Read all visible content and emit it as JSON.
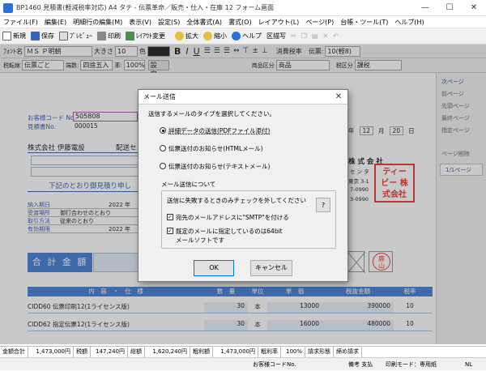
{
  "window": {
    "title": "BP1460 見積書(軽減税率対応) A4 タテ - 伝票革命／販売・仕入・在庫 12 フォーム画面",
    "min": "—",
    "max": "☐",
    "close": "✕"
  },
  "menu": [
    "ファイル(F)",
    "編集(E)",
    "明細行の編集(M)",
    "表示(V)",
    "設定(S)",
    "全体書式(A)",
    "書式(O)",
    "レイアウト(L)",
    "ページ(P)",
    "台帳・ツール(T)",
    "ヘルプ(H)"
  ],
  "toolbar": {
    "new": "新規",
    "save": "保存",
    "preview": "ﾌﾟﾚﾋﾞｭｰ",
    "print": "印刷",
    "layout": "ﾚｲｱｳﾄ変更",
    "zoom_in": "拡大",
    "zoom_out": "縮小",
    "help": "ヘルプ",
    "grid": "区描写"
  },
  "format_bar": {
    "font_label": "ﾌｫﾝﾄ名",
    "font": "ＭＳ Ｐ明朝",
    "size_label": "大きさ",
    "size": "10",
    "color_label": "色",
    "tax_label": "消費税率",
    "voucher_label": "伝票:",
    "voucher": "10(軽8)"
  },
  "toolbar3": {
    "tax_mode": "税転嫁",
    "tax_mode_value": "伝票ごと",
    "rounding": "端数:",
    "rounding_value": "四捨五入",
    "rate": "率:",
    "rate_value": "100%",
    "settings": "設定..",
    "product_label": "商品区分",
    "product_value": "商品",
    "tax_kind_label": "税区分",
    "tax_kind_value": "課税"
  },
  "document": {
    "customer_code_label": "お客様コード No.",
    "customer_code": "505808",
    "estimate_no_label": "見積書No.",
    "estimate_no": "000015",
    "customer_name": "株式会社 伊藤電設",
    "delivery_label": "配送セ",
    "date_year": "年",
    "date_month": "12",
    "date_month_unit": "月",
    "date_day": "20",
    "date_day_unit": "日",
    "company_partial": "株 式 会 社",
    "company_sub": "セ ン タ",
    "company_addr": "東京 3-1",
    "company_tel": "7-0990",
    "company_fax": "3-0990",
    "stamp": [
      "ティー",
      "ビー 株",
      "式会社"
    ],
    "greeting": "下記のとおり御見積り申し",
    "rows": [
      {
        "label": "納入期日",
        "value": "2022 年"
      },
      {
        "label": "受渡場所",
        "value": "御打合わせのとおり"
      },
      {
        "label": "取引方法",
        "value": "従来のとおり"
      },
      {
        "label": "有効期限",
        "value": "2022 年"
      }
    ],
    "total_label": "合 計 金 額",
    "seal": "鹿\n山",
    "table_headers": [
      "内　容　・　仕　様",
      "数　量",
      "単位",
      "単　価",
      "税抜金額",
      "税率"
    ],
    "lines": [
      {
        "item": "CIDD60 伝票印刷12(1ライセンス版)",
        "qty": "30",
        "unit": "本",
        "price": "13000",
        "amount": "390000",
        "rate": "10"
      },
      {
        "item": "CIDD62 指定伝票12(1ライセンス版)",
        "qty": "30",
        "unit": "本",
        "price": "16000",
        "amount": "480000",
        "rate": "10"
      }
    ]
  },
  "nav": {
    "next": "次ページ",
    "prev": "前ページ",
    "first": "先頭ページ",
    "last": "最終ページ",
    "goto": "指定ページ",
    "delete": "ページ削除",
    "page": "1/1ページ"
  },
  "status": {
    "subtotal_label": "金額合計",
    "subtotal": "1,473,000円",
    "tax_label": "税額",
    "tax": "147,240円",
    "total_label": "総額",
    "total": "1,620,240円",
    "profit_label": "粗利額",
    "profit": "1,473,000円",
    "margin_label": "粗利率",
    "margin": "100%",
    "form_label": "請求形態",
    "close_label": "締め請求"
  },
  "footer": {
    "customer": "お客様コードNo.",
    "note": "備考 支払",
    "mode": "印刷モード：専用紙",
    "nl": "NL"
  },
  "dialog": {
    "title": "メール送信",
    "prompt": "送信するメールのタイプを選択してください。",
    "options": [
      "詳細データの送信(PDFファイル添付)",
      "伝票送付のお知らせ(HTMLメール)",
      "伝票送付のお知らせ(テキストメール)"
    ],
    "selected": 0,
    "group_title": "メール送信について",
    "group_text": "送信に失敗するときのみチェックを外してください",
    "help": "?",
    "check1": "宛先のメールアドレスに\"SMTP\"を付ける",
    "check2": "既定のメールに指定しているのは64bitメールソフトです",
    "ok": "OK",
    "cancel": "キャンセル"
  }
}
